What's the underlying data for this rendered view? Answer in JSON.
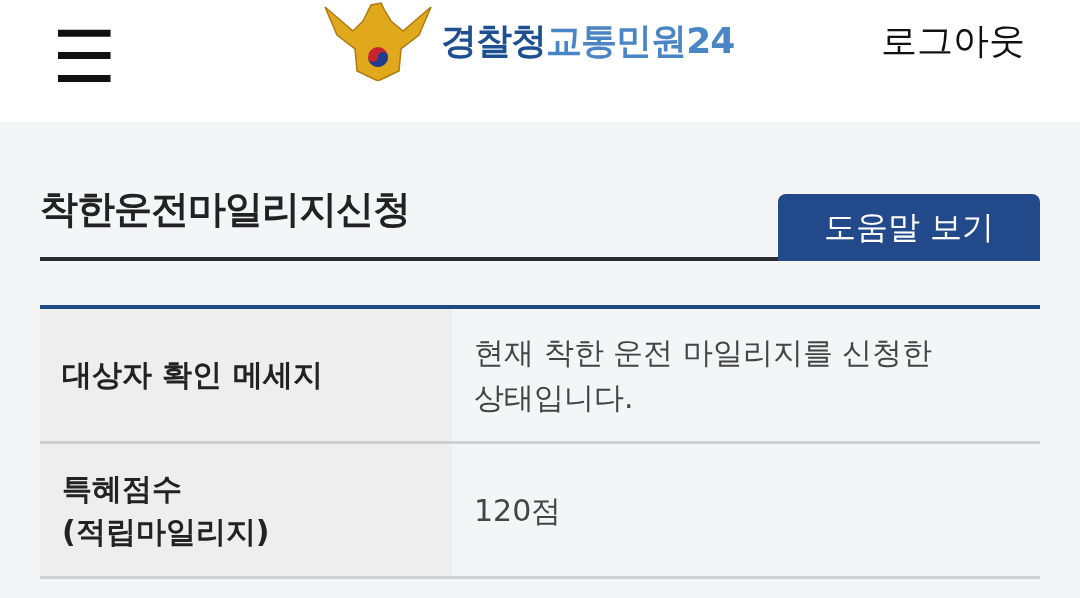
{
  "header": {
    "menu_icon": "☰",
    "logo_parts": [
      {
        "text": "경찰청",
        "color": "#1d4f91"
      },
      {
        "text": "교통민원24",
        "color": "#4a86c5"
      }
    ],
    "logout": "로그아웃"
  },
  "page": {
    "title": "착한운전마일리지신청",
    "help_button": "도움말 보기"
  },
  "table": {
    "rows": [
      {
        "label": "대상자 확인 메세지",
        "value": "현재 착한 운전 마일리지를 신청한 상태입니다."
      },
      {
        "label": "특혜점수\n(적립마일리지)",
        "value": "120점"
      }
    ]
  }
}
